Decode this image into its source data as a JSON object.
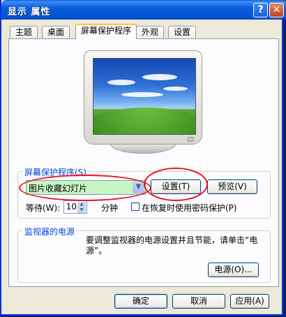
{
  "window": {
    "title": "显示 属性",
    "help": "?",
    "close": "✕"
  },
  "tabs": [
    "主题",
    "桌面",
    "屏幕保护程序",
    "外观",
    "设置"
  ],
  "screensaver": {
    "group_label": "屏幕保护程序(S)",
    "selected": "图片收藏幻灯片",
    "settings_button": "设置(T)",
    "preview_button": "预览(V)",
    "wait_label": "等待(W):",
    "wait_value": "10",
    "wait_unit": "分钟",
    "password_label": "在恢复时使用密码保护(P)"
  },
  "power": {
    "group_label": "监视器的电源",
    "description": "要调整监视器的电源设置并且节能，请单击“电源”。",
    "power_button": "电源(O)..."
  },
  "footer": {
    "ok": "确定",
    "cancel": "取消",
    "apply": "应用(A)"
  },
  "colors": {
    "selection_bg": "#c7f5c4",
    "annotation": "#e8141e",
    "group_label": "#0046d5"
  }
}
